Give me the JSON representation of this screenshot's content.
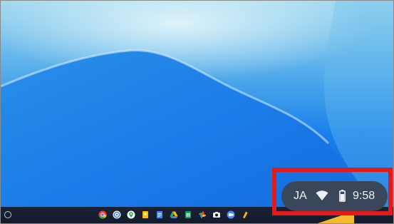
{
  "shelf": {
    "apps": [
      {
        "icon": "chrome-icon"
      },
      {
        "icon": "chrome-alt-icon"
      },
      {
        "icon": "maps-icon"
      },
      {
        "icon": "keep-icon"
      },
      {
        "icon": "docs-icon"
      },
      {
        "icon": "drive-icon"
      },
      {
        "icon": "sheets-icon"
      },
      {
        "icon": "photos-icon"
      },
      {
        "icon": "camera-icon"
      },
      {
        "icon": "meet-icon"
      },
      {
        "icon": "files-icon"
      }
    ]
  },
  "status_tray": {
    "input_method": "JA",
    "time": "9:58",
    "icons": [
      "wifi-icon",
      "battery-icon"
    ]
  },
  "colors": {
    "highlight": "#e21a1a",
    "tray": "#3a475b",
    "shelf": "#161d2f",
    "wallpaper": "#1576e8"
  }
}
